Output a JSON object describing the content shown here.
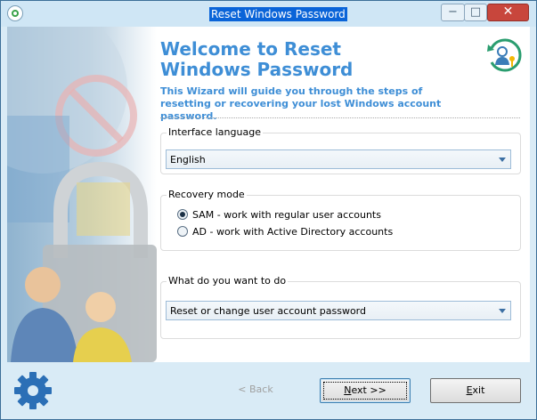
{
  "window": {
    "title": "Reset Windows Password"
  },
  "header": {
    "title": "Welcome to Reset Windows Password",
    "subtitle": "This Wizard will guide you through the steps of resetting or recovering your lost Windows account password."
  },
  "interface_language": {
    "label": "Interface language",
    "selected": "English"
  },
  "recovery_mode": {
    "label": "Recovery mode",
    "options": [
      {
        "label": "SAM - work with regular user accounts",
        "selected": true
      },
      {
        "label": "AD - work with Active Directory accounts",
        "selected": false
      }
    ]
  },
  "task": {
    "label": "What do you want to do",
    "selected": "Reset or change user account password"
  },
  "buttons": {
    "back": {
      "mnemonic": "<",
      "rest": "< Back",
      "enabled": false
    },
    "next": {
      "mnemonic": "N",
      "rest": "ext >>"
    },
    "exit": {
      "mnemonic": "E",
      "rest": "xit"
    }
  },
  "colors": {
    "accent": "#3e8ed6",
    "title_highlight": "#0a64d8",
    "close_button": "#c8463c",
    "chrome": "#d9ebf6"
  },
  "icons": [
    "app-icon",
    "minimize-icon",
    "maximize-icon",
    "close-icon",
    "reset-user-key-icon",
    "gear-icon",
    "dropdown-arrow-icon"
  ]
}
